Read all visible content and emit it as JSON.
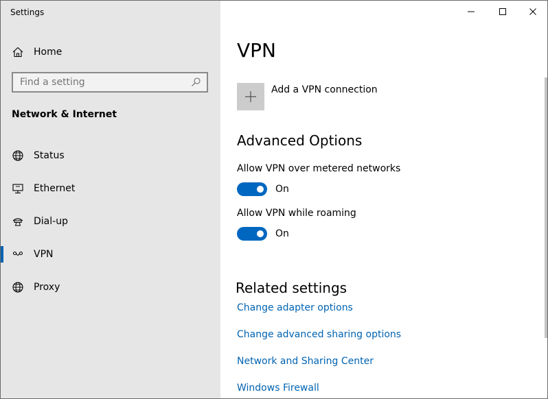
{
  "window": {
    "title": "Settings"
  },
  "sidebar": {
    "home_label": "Home",
    "search_placeholder": "Find a setting",
    "section_title": "Network & Internet",
    "items": [
      {
        "label": "Status",
        "icon": "globe-icon"
      },
      {
        "label": "Ethernet",
        "icon": "ethernet-icon"
      },
      {
        "label": "Dial-up",
        "icon": "dialup-icon"
      },
      {
        "label": "VPN",
        "icon": "vpn-icon",
        "selected": true
      },
      {
        "label": "Proxy",
        "icon": "globe-icon"
      }
    ]
  },
  "main": {
    "title": "VPN",
    "add_vpn_label": "Add a VPN connection",
    "advanced_title": "Advanced Options",
    "options": [
      {
        "label": "Allow VPN over metered networks",
        "state": "On",
        "on": true
      },
      {
        "label": "Allow VPN while roaming",
        "state": "On",
        "on": true
      }
    ],
    "related_title": "Related settings",
    "related_links": [
      "Change adapter options",
      "Change advanced sharing options",
      "Network and Sharing Center",
      "Windows Firewall"
    ]
  },
  "colors": {
    "accent": "#0067c0",
    "link": "#0063b1",
    "sidebar_bg": "#e6e6e6"
  }
}
